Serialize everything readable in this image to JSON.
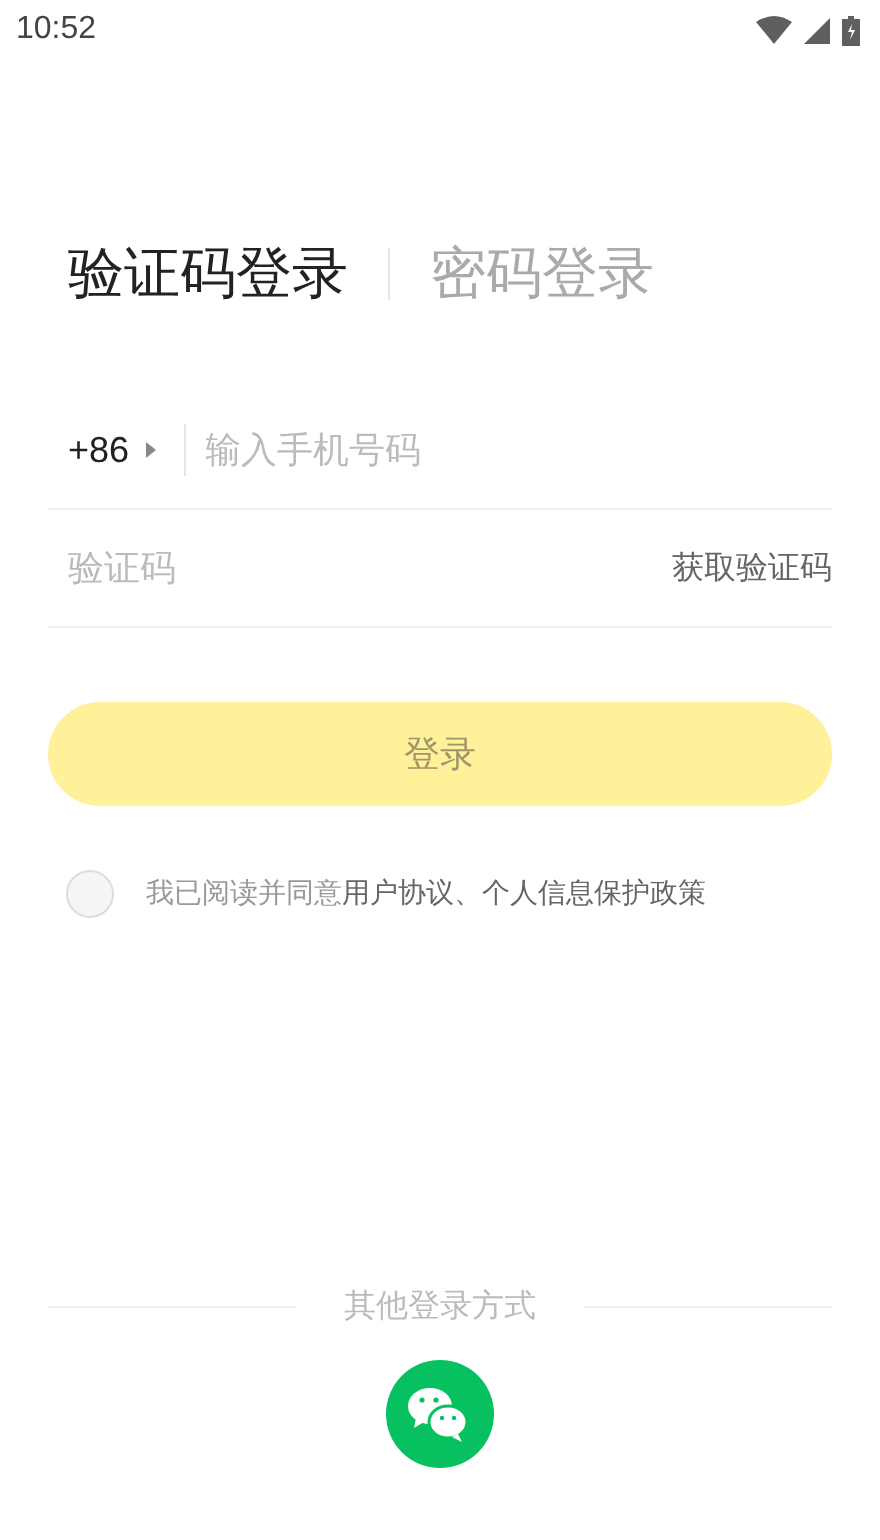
{
  "status_bar": {
    "time": "10:52"
  },
  "tabs": [
    {
      "label": "验证码登录",
      "selected": true
    },
    {
      "label": "密码登录",
      "selected": false
    }
  ],
  "phone_field": {
    "country_code": "+86",
    "placeholder": "输入手机号码"
  },
  "code_field": {
    "placeholder": "验证码",
    "action": "获取验证码"
  },
  "login_button": {
    "label": "登录",
    "disabled": true
  },
  "agreement": {
    "checked": false,
    "text": "我已阅读并同意**用户协议、个人信息保护政策**"
  },
  "other_login": {
    "title": "其他登录方式"
  }
}
